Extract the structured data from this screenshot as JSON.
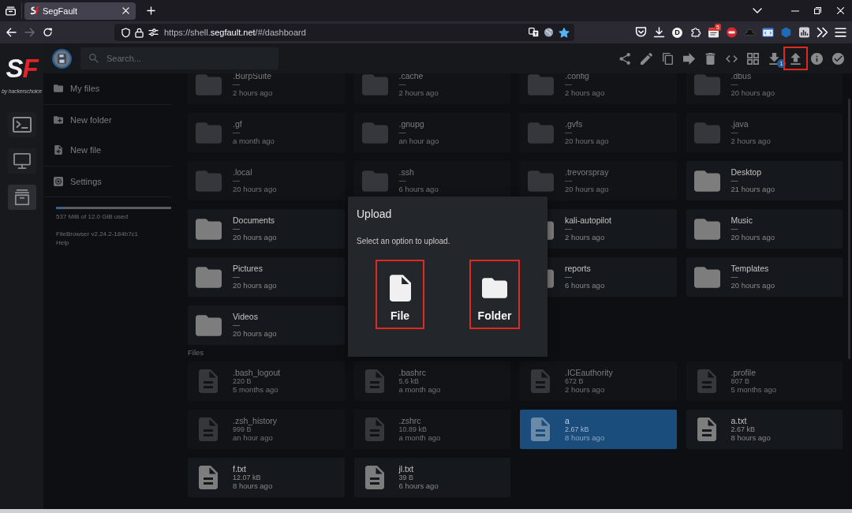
{
  "browser": {
    "tabs": [
      {
        "title": "SegFault",
        "selected": true
      }
    ],
    "nav": [
      {
        "disabled": false
      },
      {
        "disabled": true
      },
      {
        "disabled": false
      }
    ],
    "url": "https://shell.**segfault.net**/#/dashboard",
    "bookmarked": true,
    "extension_letter": "D",
    "extension_badge": "5"
  },
  "rail": {
    "logo": "S**F**",
    "tagline": "by hackerschoice",
    "items": [
      {
        "selected": false
      },
      {
        "selected": false
      },
      {
        "selected": true
      }
    ]
  },
  "header": {
    "search": {
      "placeholder": "Search..."
    },
    "actions": [
      {
        "highlighted": false
      },
      {
        "highlighted": false
      },
      {
        "highlighted": false
      },
      {
        "highlighted": false
      },
      {
        "highlighted": false
      },
      {
        "highlighted": false
      },
      {
        "highlighted": false
      },
      {
        "highlighted": false,
        "badge": "1"
      },
      {
        "highlighted": true
      },
      {
        "highlighted": false
      },
      {
        "highlighted": false
      }
    ]
  },
  "sidebar": {
    "groups": [
      [
        {
          "label": "My files"
        }
      ],
      [
        {
          "label": "New folder"
        },
        {
          "label": "New file"
        }
      ],
      [
        {
          "label": "Settings"
        }
      ]
    ],
    "usage": {
      "level": 0.04,
      "text": "537 MiB of 12.0 GiB used"
    },
    "version": "FileBrowser v2.24.2-184b7c1",
    "help": "Help"
  },
  "listing": {
    "folders": [
      {
        "name": ".BurpSuite",
        "size": "—",
        "modified": "2 hours ago",
        "hidden": true,
        "selected": false
      },
      {
        "name": ".cache",
        "size": "—",
        "modified": "2 hours ago",
        "hidden": true,
        "selected": false
      },
      {
        "name": ".config",
        "size": "—",
        "modified": "2 hours ago",
        "hidden": true,
        "selected": false
      },
      {
        "name": ".dbus",
        "size": "—",
        "modified": "20 hours ago",
        "hidden": true,
        "selected": false
      },
      {
        "name": ".gf",
        "size": "—",
        "modified": "a month ago",
        "hidden": true,
        "selected": false
      },
      {
        "name": ".gnupg",
        "size": "—",
        "modified": "an hour ago",
        "hidden": true,
        "selected": false
      },
      {
        "name": ".gvfs",
        "size": "—",
        "modified": "20 hours ago",
        "hidden": true,
        "selected": false
      },
      {
        "name": ".java",
        "size": "—",
        "modified": "2 hours ago",
        "hidden": true,
        "selected": false
      },
      {
        "name": ".local",
        "size": "—",
        "modified": "20 hours ago",
        "hidden": true,
        "selected": false
      },
      {
        "name": ".ssh",
        "size": "—",
        "modified": "6 hours ago",
        "hidden": true,
        "selected": false
      },
      {
        "name": ".trevorspray",
        "size": "—",
        "modified": "20 hours ago",
        "hidden": true,
        "selected": false
      },
      {
        "name": "Desktop",
        "size": "—",
        "modified": "21 hours ago",
        "hidden": false,
        "selected": false
      },
      {
        "name": "Documents",
        "size": "—",
        "modified": "20 hours ago",
        "hidden": false,
        "selected": false
      },
      {
        "name": "kali-autopilot",
        "size": "—",
        "modified": "2 hours ago",
        "hidden": false,
        "selected": false
      },
      {
        "name": "Music",
        "size": "—",
        "modified": "20 hours ago",
        "hidden": false,
        "selected": false
      },
      {
        "name": "Pictures",
        "size": "—",
        "modified": "20 hours ago",
        "hidden": false,
        "selected": false
      },
      {
        "name": "reports",
        "size": "—",
        "modified": "6 hours ago",
        "hidden": false,
        "selected": false
      },
      {
        "name": "Templates",
        "size": "—",
        "modified": "20 hours ago",
        "hidden": false,
        "selected": false
      },
      {
        "name": "Videos",
        "size": "—",
        "modified": "20 hours ago",
        "hidden": false,
        "selected": false
      }
    ],
    "files_label": "Files",
    "files": [
      {
        "name": ".bash_logout",
        "size": "220 B",
        "modified": "5 months ago",
        "hidden": true,
        "selected": false
      },
      {
        "name": ".bashrc",
        "size": "5.6 kB",
        "modified": "a month ago",
        "hidden": true,
        "selected": false
      },
      {
        "name": ".ICEauthority",
        "size": "672 B",
        "modified": "2 hours ago",
        "hidden": true,
        "selected": false
      },
      {
        "name": ".profile",
        "size": "807 B",
        "modified": "5 months ago",
        "hidden": true,
        "selected": false
      },
      {
        "name": ".zsh_history",
        "size": "999 B",
        "modified": "an hour ago",
        "hidden": true,
        "selected": false
      },
      {
        "name": ".zshrc",
        "size": "10.89 kB",
        "modified": "a month ago",
        "hidden": true,
        "selected": false
      },
      {
        "name": "a",
        "size": "2.67 kB",
        "modified": "8 hours ago",
        "hidden": false,
        "selected": true
      },
      {
        "name": "a.txt",
        "size": "2.67 kB",
        "modified": "8 hours ago",
        "hidden": false,
        "selected": false
      },
      {
        "name": "f.txt",
        "size": "12.07 kB",
        "modified": "8 hours ago",
        "hidden": false,
        "selected": false
      },
      {
        "name": "jl.txt",
        "size": "39 B",
        "modified": "6 hours ago",
        "hidden": false,
        "selected": false
      }
    ]
  },
  "dialog": {
    "title": "Upload",
    "message": "Select an option to upload.",
    "options": [
      {
        "label": "File",
        "highlighted": true
      },
      {
        "label": "Folder",
        "highlighted": true
      }
    ]
  }
}
